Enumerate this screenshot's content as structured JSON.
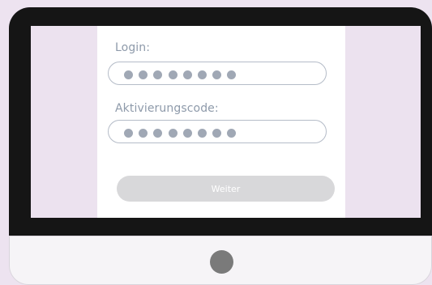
{
  "form": {
    "login_label": "Login:",
    "login_mask_length": 8,
    "code_label": "Aktivierungscode:",
    "code_mask_length": 8,
    "submit_label": "Weiter"
  },
  "colors": {
    "background": "#ede3f0",
    "bezel": "#151515",
    "label_text": "#8e9aaa",
    "mask_dot": "#a0a8b5",
    "button_disabled": "#d8d8da"
  }
}
